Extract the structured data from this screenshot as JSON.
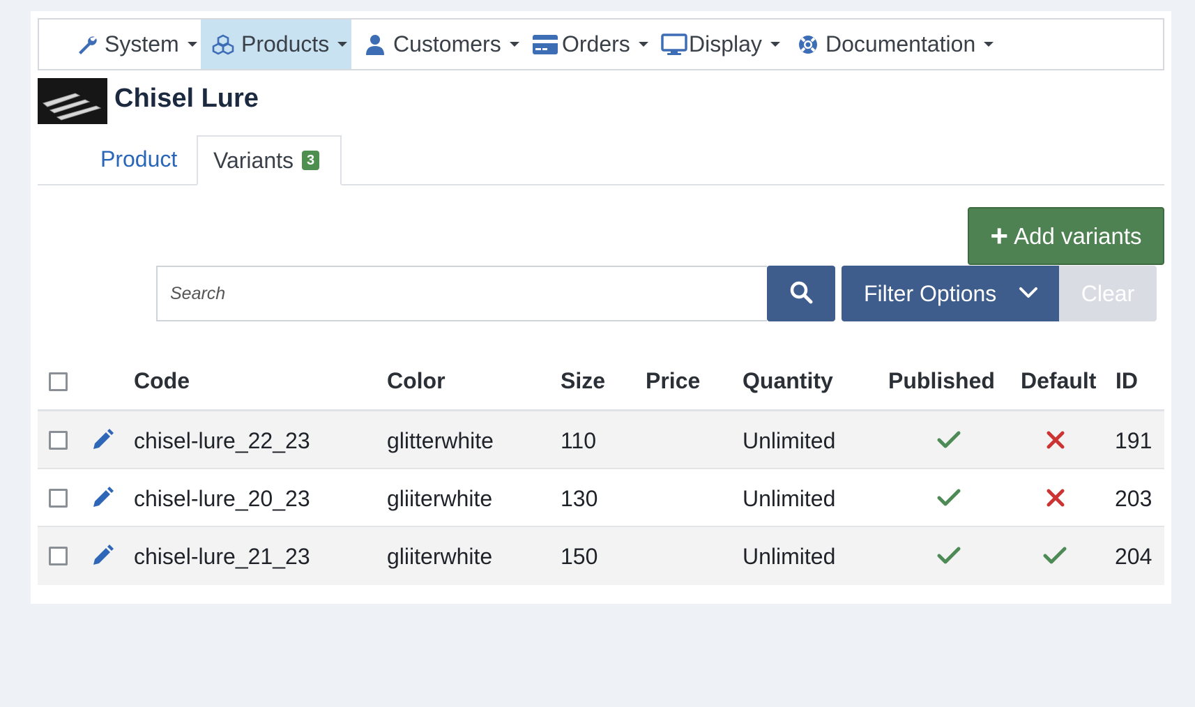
{
  "nav": {
    "items": [
      {
        "label": "System",
        "icon": "wrench-icon"
      },
      {
        "label": "Products",
        "icon": "cubes-icon",
        "active": true
      },
      {
        "label": "Customers",
        "icon": "user-icon"
      },
      {
        "label": "Orders",
        "icon": "credit-card-icon"
      },
      {
        "label": "Display",
        "icon": "desktop-icon"
      },
      {
        "label": "Documentation",
        "icon": "life-ring-icon"
      }
    ]
  },
  "product": {
    "title": "Chisel Lure"
  },
  "tabs": {
    "product_label": "Product",
    "variants_label": "Variants",
    "variants_count": "3"
  },
  "toolbar": {
    "add_label": "Add variants",
    "search_placeholder": "Search",
    "filter_label": "Filter Options",
    "clear_label": "Clear"
  },
  "table": {
    "headers": {
      "code": "Code",
      "color": "Color",
      "size": "Size",
      "price": "Price",
      "quantity": "Quantity",
      "published": "Published",
      "default": "Default",
      "id": "ID"
    },
    "rows": [
      {
        "code": "chisel-lure_22_23",
        "color": "glitterwhite",
        "size": "110",
        "price": "",
        "quantity": "Unlimited",
        "published": true,
        "default": false,
        "id": "191"
      },
      {
        "code": "chisel-lure_20_23",
        "color": "gliiterwhite",
        "size": "130",
        "price": "",
        "quantity": "Unlimited",
        "published": true,
        "default": false,
        "id": "203"
      },
      {
        "code": "chisel-lure_21_23",
        "color": "gliiterwhite",
        "size": "150",
        "price": "",
        "quantity": "Unlimited",
        "published": true,
        "default": true,
        "id": "204"
      }
    ]
  },
  "colors": {
    "accent": "#3f5d8c",
    "success": "#4e8252",
    "check": "#4e8a55",
    "cross": "#cc3333",
    "link": "#2a66b8",
    "nav_active": "#c8e2f2"
  }
}
